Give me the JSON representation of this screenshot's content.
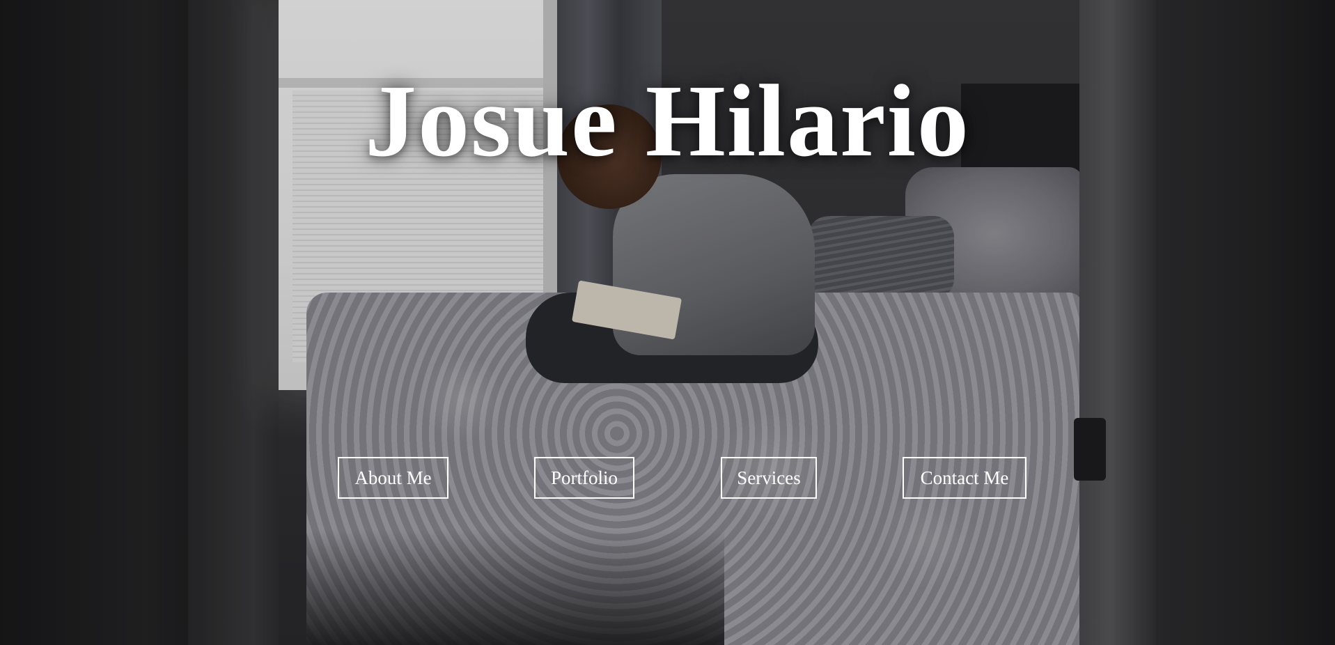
{
  "hero": {
    "title": "Josue Hilario",
    "text_color": "#ffffff",
    "background_image": "dim-bedroom-photo"
  },
  "nav": {
    "items": [
      {
        "label": "About Me"
      },
      {
        "label": "Portfolio"
      },
      {
        "label": "Services"
      },
      {
        "label": "Contact Me"
      }
    ],
    "border_color": "#ffffff"
  }
}
